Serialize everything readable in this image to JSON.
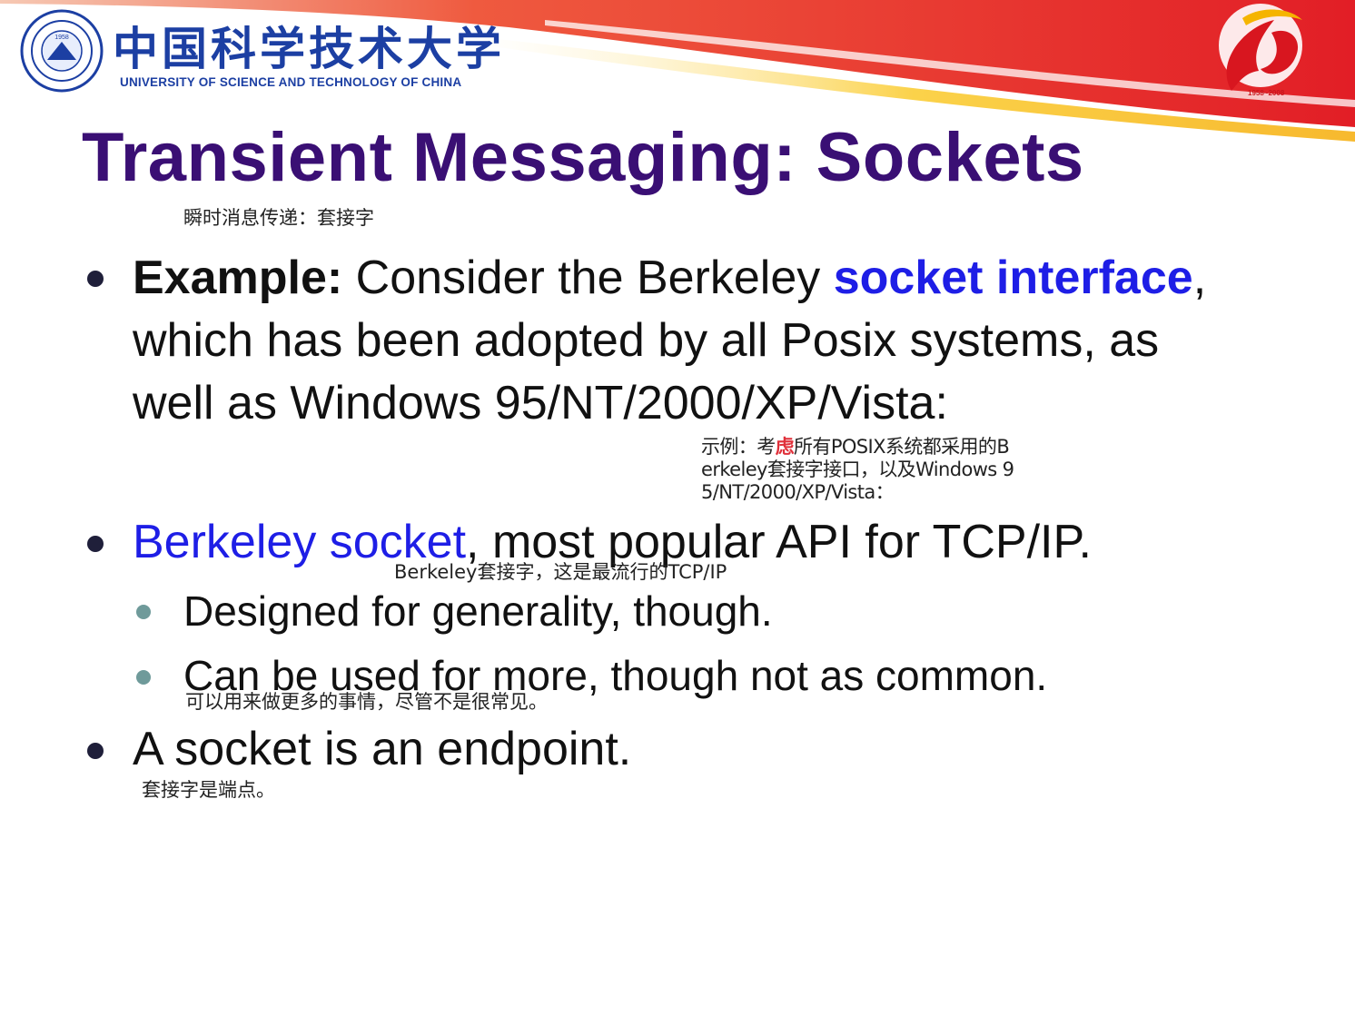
{
  "header": {
    "university_cn": "中国科学技术大学",
    "university_en": "UNIVERSITY OF SCIENCE AND TECHNOLOGY OF CHINA",
    "seal_year": "1958",
    "anniversary_years": "1958~2008"
  },
  "slide": {
    "title": "Transient Messaging: Sockets",
    "title_note": "瞬时消息传递：套接字",
    "bullet1": {
      "label": "Example:",
      "text_before": " Consider the Berkeley ",
      "highlight": "socket interface",
      "text_after": ", which has been adopted by all Posix systems, as well as Windows 95/NT/2000/XP/Vista:",
      "note_part1": "示例：考",
      "note_mark": "虑",
      "note_part2": "所有POSIX系统都采用的B\nerkeley套接字接口，以及Windows 9\n5/NT/2000/XP/Vista："
    },
    "bullet2": {
      "highlight": "Berkeley socket",
      "text": ", most popular API for TCP/IP.",
      "note": "Berkeley套接字，这是最流行的TCP/IP"
    },
    "sub_bullet1": "Designed for generality, though.",
    "sub_bullet2": "Can be used for more, though not as common.",
    "sub_bullet2_note": "可以用来做更多的事情，尽管不是很常见。",
    "bullet3": "A socket is an endpoint.",
    "bullet3_note": "套接字是端点。"
  },
  "colors": {
    "title": "#3a0f74",
    "highlight": "#1e1ee6",
    "header_red": "#e0262d",
    "header_blue": "#1c3fa3"
  }
}
